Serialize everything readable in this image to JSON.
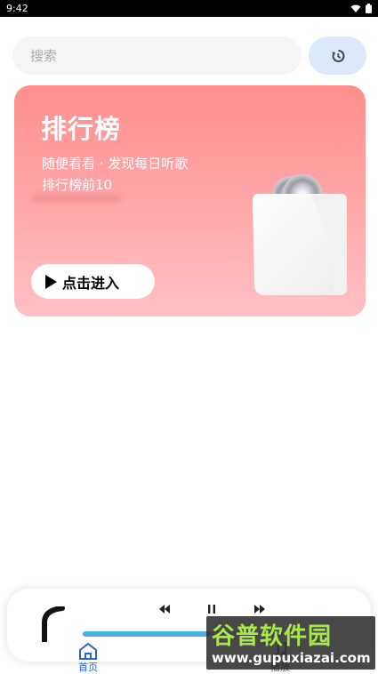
{
  "status_bar": {
    "time": "9:42",
    "wifi_icon": "wifi-icon",
    "battery_icon": "battery-icon"
  },
  "search": {
    "placeholder": "搜索",
    "value": "",
    "history_icon": "history-icon"
  },
  "card": {
    "title": "排行榜",
    "subtitle_line1": "随便看看 · 发现每日听歌",
    "subtitle_line2": "排行榜前10",
    "enter_label": "点击进入",
    "illustration": "shopping-bag-with-cds",
    "gradient_top": "#ff8f8b",
    "gradient_bottom": "#ffc0c6"
  },
  "player": {
    "cover_icon": "album-cover",
    "prev_icon": "rewind-icon",
    "pause_icon": "pause-icon",
    "next_icon": "fast-forward-icon",
    "progress": 0.62,
    "accent": "#4ab1e6"
  },
  "tabs": [
    {
      "label": "首页",
      "icon": "home-icon",
      "active": true
    },
    {
      "label": "播放",
      "icon": "music-icon",
      "active": false
    }
  ],
  "watermark": {
    "brand": "谷普软件园",
    "url": "www.gupuxiazai.com"
  }
}
